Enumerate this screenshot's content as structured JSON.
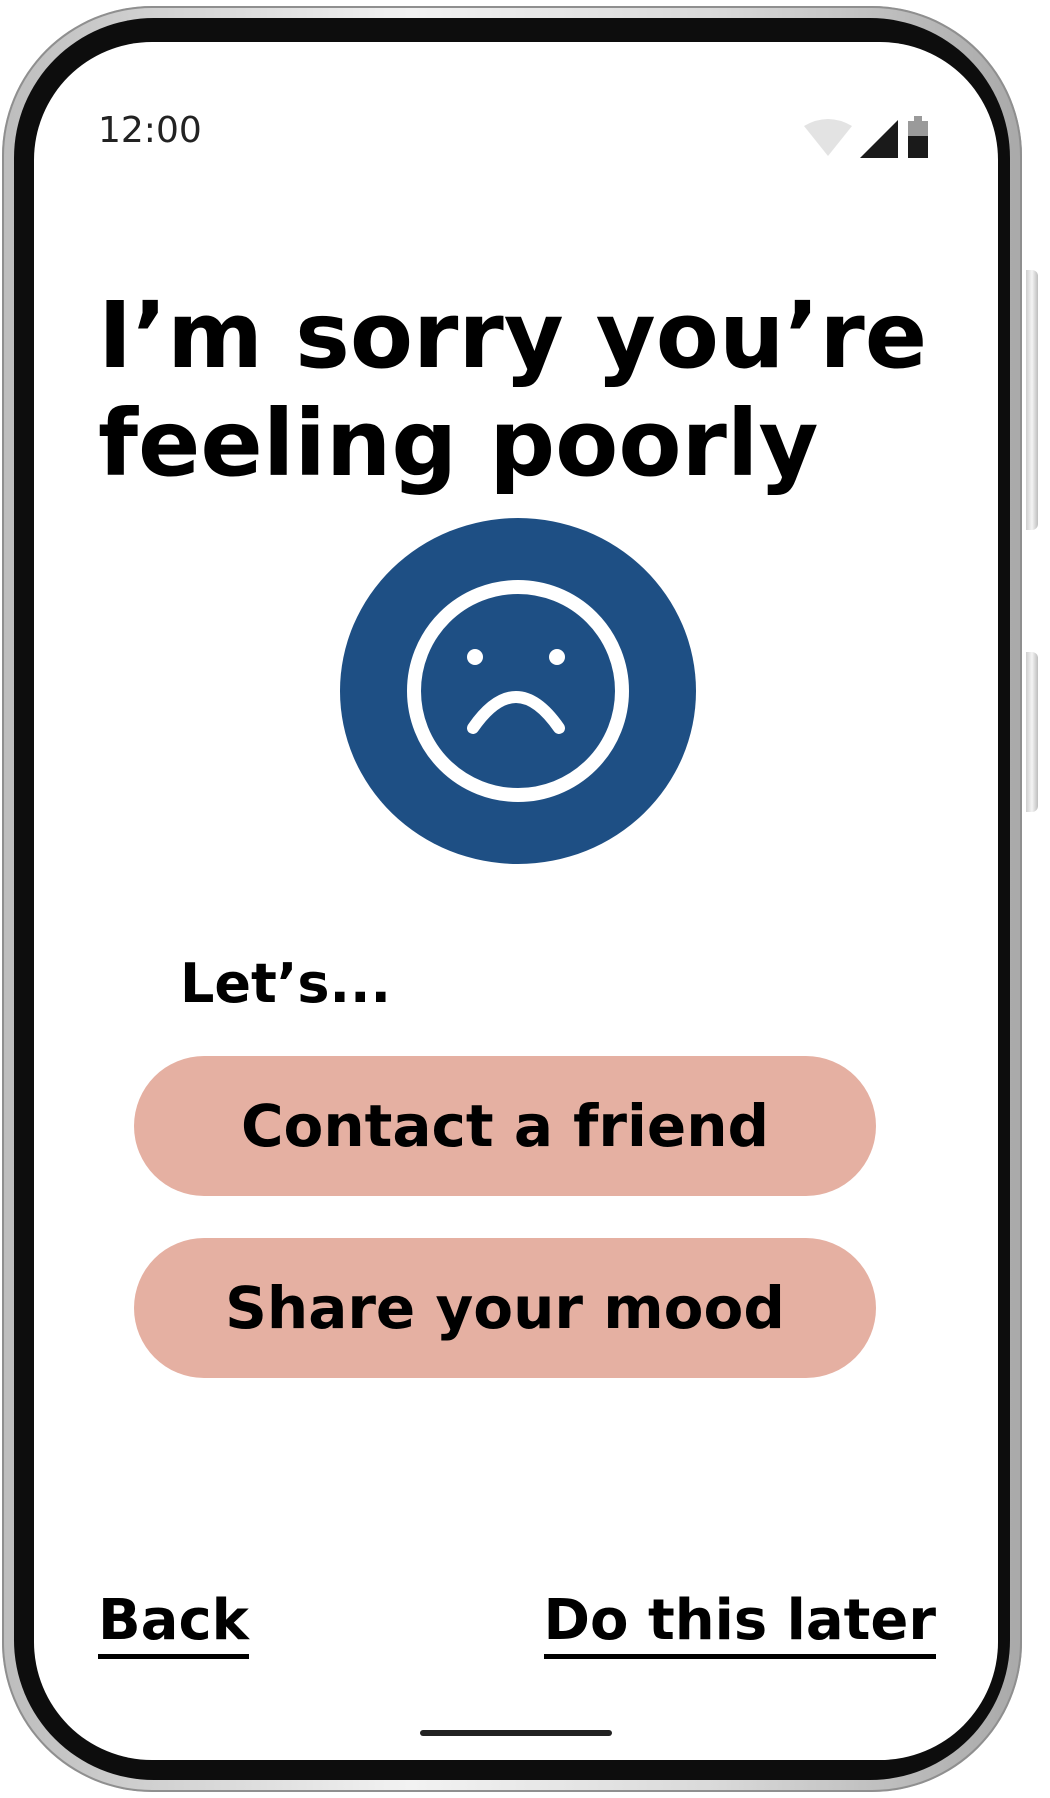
{
  "status_bar": {
    "time": "12:00",
    "icons": [
      "wifi-icon",
      "signal-icon",
      "battery-icon"
    ]
  },
  "headline": "I’m sorry you’re feeling poorly",
  "mood": {
    "icon": "sad-face-icon",
    "color": "#1e4f84"
  },
  "prompt": "Let’s...",
  "actions": {
    "contact_friend": "Contact a friend",
    "share_mood": "Share your mood",
    "button_color": "#e5b0a2"
  },
  "footer": {
    "back": "Back",
    "later": "Do this later"
  }
}
